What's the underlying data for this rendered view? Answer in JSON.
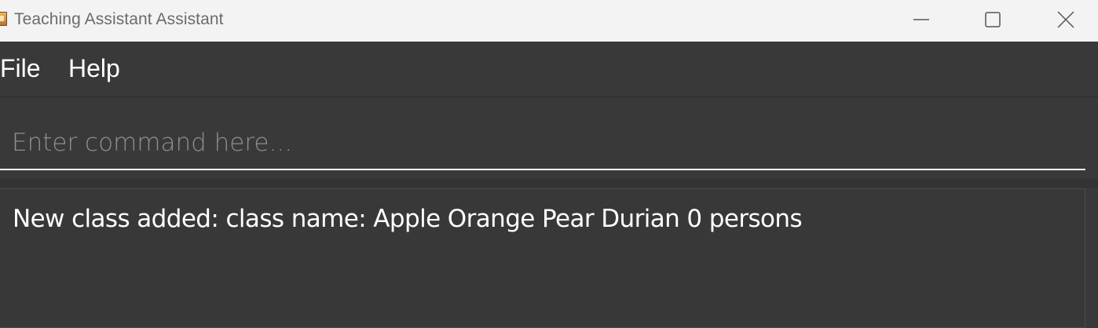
{
  "window": {
    "title": "Teaching Assistant Assistant",
    "icon": "app-icon"
  },
  "window_controls": {
    "minimize_icon": "minimize-icon",
    "maximize_icon": "maximize-icon",
    "close_icon": "close-icon"
  },
  "menu": {
    "items": [
      {
        "label": "File"
      },
      {
        "label": "Help"
      }
    ]
  },
  "command": {
    "placeholder": "Enter command here...",
    "value": ""
  },
  "result": {
    "text": "New class added: class name: Apple Orange Pear Durian 0 persons"
  },
  "colors": {
    "background": "#393939",
    "titlebar": "#f3f3f3",
    "text": "#ffffff",
    "placeholder": "#8f8f8f"
  }
}
